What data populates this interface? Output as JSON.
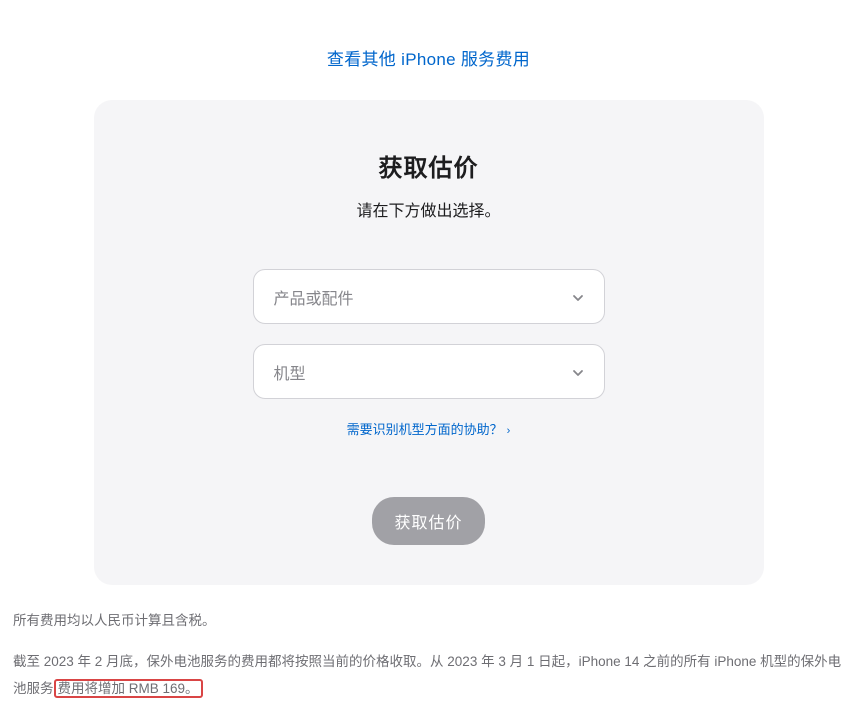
{
  "topLink": "查看其他 iPhone 服务费用",
  "card": {
    "title": "获取估价",
    "subtitle": "请在下方做出选择。",
    "selectProduct": "产品或配件",
    "selectModel": "机型",
    "helpLink": "需要识别机型方面的协助？",
    "submitButton": "获取估价"
  },
  "footer": {
    "note": "所有费用均以人民币计算且含税。",
    "paragraphStart": "截至 2023 年 2 月底，保外电池服务的费用都将按照当前的价格收取。从 2023 年 3 月 1 日起，iPhone 14 之前的所有 iPhone 机型的保外电池服务",
    "highlighted": "费用将增加 RMB 169。"
  }
}
